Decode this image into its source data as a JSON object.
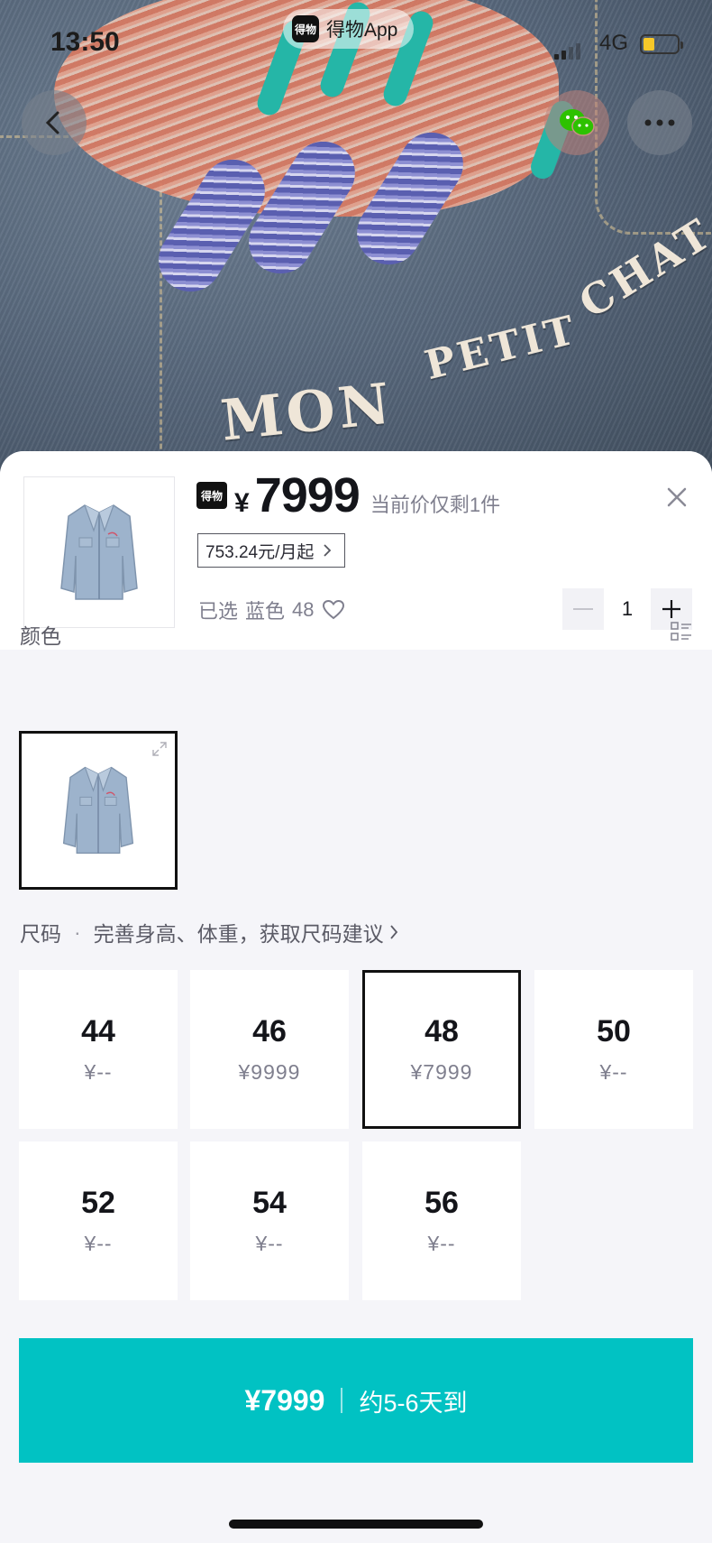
{
  "status_bar": {
    "time": "13:50",
    "app_name": "得物App",
    "app_logo_text": "得物",
    "network": "4G"
  },
  "product": {
    "brand_badge": "得物",
    "currency": "¥",
    "price": "7999",
    "stock_note": "当前价仅剩1件",
    "installment": "753.24元/月起",
    "selected_label": "已选",
    "selected_color": "蓝色",
    "selected_size": "48",
    "quantity": "1"
  },
  "hero": {
    "line1": "MON",
    "line2": "PETIT",
    "line3": "CHAT"
  },
  "color_section": {
    "title": "颜色"
  },
  "size_section": {
    "title": "尺码",
    "hint": "完善身高、体重，获取尺码建议"
  },
  "sizes": [
    {
      "size": "44",
      "price": "¥--",
      "selected": false
    },
    {
      "size": "46",
      "price": "¥9999",
      "selected": false
    },
    {
      "size": "48",
      "price": "¥7999",
      "selected": true
    },
    {
      "size": "50",
      "price": "¥--",
      "selected": false
    },
    {
      "size": "52",
      "price": "¥--",
      "selected": false
    },
    {
      "size": "54",
      "price": "¥--",
      "selected": false
    },
    {
      "size": "56",
      "price": "¥--",
      "selected": false
    }
  ],
  "buy_button": {
    "price": "¥7999",
    "eta": "约5-6天到"
  },
  "colors": {
    "accent": "#01c2c3",
    "text": "#14151a",
    "muted": "#7f7f8e"
  },
  "icons": [
    "back-icon",
    "wechat-icon",
    "more-icon",
    "close-icon",
    "chevron-right-icon",
    "heart-icon",
    "minus-icon",
    "plus-icon",
    "list-view-icon",
    "expand-icon"
  ]
}
